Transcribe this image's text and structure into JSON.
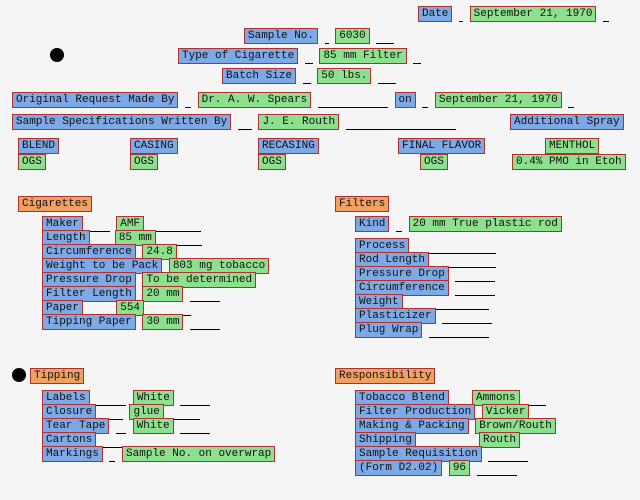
{
  "header": {
    "date_label": "Date",
    "date_value": "September 21, 1970",
    "sample_no_label": "Sample No.",
    "sample_no_value": "6030",
    "type_label": "Type of Cigarette",
    "type_value": "85 mm Filter",
    "batch_label": "Batch Size",
    "batch_value": "50 lbs."
  },
  "request": {
    "label": "Original Request Made By",
    "by": "Dr. A. W. Spears",
    "on_label": "on",
    "on_value": "September 21, 1970",
    "spec_label": "Sample Specifications Written By",
    "spec_value": "J. E. Routh",
    "addl_label": "Additional Spray"
  },
  "process": {
    "blend": "BLEND",
    "casing": "CASING",
    "recasing": "RECASING",
    "final_flavor": "FINAL FLAVOR",
    "menthol": "MENTHOL",
    "ogs": "OGS",
    "menthol_val": "0.4% PMO in Etoh"
  },
  "cigarettes": {
    "title": "Cigarettes",
    "maker_l": "Maker",
    "maker_v": "AMF",
    "length_l": "Length",
    "length_v": "85 mm",
    "circ_l": "Circumference",
    "circ_v": "24.8",
    "wpm_l": "Weight to be Pack",
    "wpm_v": "803 mg tobacco",
    "pd_l": "Pressure Drop",
    "pd_v": "To be determined",
    "flen_l": "Filter Length",
    "flen_v": "20 mm",
    "paper_l": "Paper",
    "paper_v": "554",
    "tip_l": "Tipping Paper",
    "tip_v": "30 mm"
  },
  "filters": {
    "title": "Filters",
    "kind_l": "Kind",
    "kind_v": "20 mm True plastic rod",
    "process_l": "Process",
    "rodlen_l": "Rod Length",
    "pd_l": "Pressure Drop",
    "circ_l": "Circumference",
    "weight_l": "Weight",
    "plast_l": "Plasticizer",
    "plug_l": "Plug Wrap"
  },
  "tipping": {
    "title": "Tipping",
    "labels_l": "Labels",
    "labels_v": "White",
    "closure_l": "Closure",
    "closure_v": "glue",
    "tear_l": "Tear Tape",
    "tear_v": "White",
    "cartons_l": "Cartons",
    "markings_l": "Markings",
    "markings_v": "Sample No. on overwrap"
  },
  "responsibility": {
    "title": "Responsibility",
    "tb_l": "Tobacco Blend",
    "tb_v": "Ammons",
    "fp_l": "Filter Production",
    "fp_v": "Vicker",
    "mp_l": "Making & Packing",
    "mp_v": "Brown/Routh",
    "ship_l": "Shipping",
    "ship_v": "Routh",
    "sr_l": "Sample Requisition",
    "form_l": "(Form D2.02)",
    "form_v": "96"
  }
}
